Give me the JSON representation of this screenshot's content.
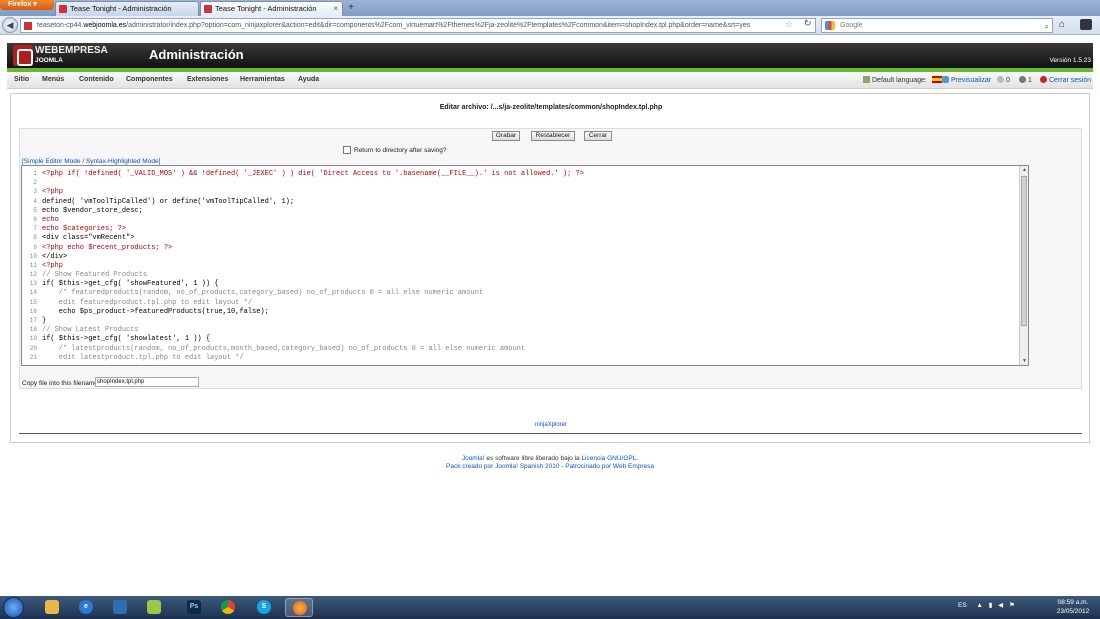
{
  "browser": {
    "menu_label": "Firefox",
    "tabs": [
      {
        "label": "Tease Tonight - Administración"
      },
      {
        "label": "Tease Tonight - Administración"
      }
    ],
    "new_tab_label": "+",
    "url_prefix": "teaseton-cp44.",
    "url_host": "webjoomla.es",
    "url_path": "/administrator/index.php?option=com_ninjaxplorer&action=edit&dir=components%2Fcom_virtuemart%2Fthemes%2Fja-zeolite%2Ftemplates%2Fcommon&item=shopIndex.tpl.php&order=name&srt=yes",
    "search_placeholder": "Google"
  },
  "header": {
    "brand": "WEBEMPRESA",
    "brand_sub": "JOOMLA",
    "title": "Administración",
    "version": "Versión 1.5.23",
    "accent_color": "#69ba2c"
  },
  "menu": {
    "items": [
      "Sitio",
      "Menús",
      "Contenido",
      "Componentes",
      "Extensiones",
      "Herramientas",
      "Ayuda"
    ],
    "default_language": "Default language:",
    "preview": "Previsualizar",
    "messages_count": "0",
    "users_count": "1",
    "logout": "Cerrar sesión"
  },
  "editor_page": {
    "title": "Editar archivo: /...s/ja-zeolite/templates/common/shopIndex.tpl.php",
    "buttons": {
      "save": "Grabar",
      "reset": "Restablecer",
      "close": "Cerrar"
    },
    "return_label": "Return to directory after saving?",
    "mode_link": "[Simple Editor Mode / Syntax-Highlighted Mode]",
    "copy_label": "Copy file into this filename",
    "copy_value": "shopIndex.tpl.php",
    "footer_link": "ninjaXplorer",
    "line_numbers": [
      "1",
      "2",
      "3",
      "4",
      "5",
      "6",
      "7",
      "8",
      "9",
      "10",
      "11",
      "12",
      "13",
      "14",
      "15",
      "16",
      "17",
      "18",
      "19",
      "20",
      "21"
    ],
    "code_lines": [
      "<?php if( !defined( '_VALID_MOS' ) && !defined( '_JEXEC' ) ) die( 'Direct Access to '.basename(__FILE__).' is not allowed.' ); ?>",
      "",
      "<?php",
      "defined( 'vmToolTipCalled') or define('vmToolTipCalled', 1);",
      "echo $vendor_store_desc;",
      "echo",
      "echo $categories; ?>",
      "<div class=\"vmRecent\">",
      "<?php echo $recent_products; ?>",
      "</div>",
      "<?php",
      "// Show Featured Products",
      "if( $this->get_cfg( 'showFeatured', 1 )) {",
      "    /* featuredproducts(random, no_of_products,category_based) no_of_products 0 = all else numeric amount",
      "    edit featuredproduct.tpl.php to edit layout */",
      "    echo $ps_product->featuredProducts(true,10,false);",
      "}",
      "// Show Latest Products",
      "if( $this->get_cfg( 'showlatest', 1 )) {",
      "    /* latestproducts(random, no_of_products,month_based,category_based) no_of_products 0 = all else numeric amount",
      "    edit latestproduct.tpl.php to edit layout */"
    ]
  },
  "footer": {
    "line1_link": "Joomla!",
    "line1_text": " es software libre liberado bajo la ",
    "line1_license": "Licencia GNU/GPL.",
    "line2": "Pack creado por Joomla! Spanish 2010 - Patrocinado por Web Empresa"
  },
  "taskbar": {
    "apps": [
      {
        "icon": "explorer-icon",
        "label": ""
      },
      {
        "icon": "ie-icon",
        "label": "e"
      },
      {
        "icon": "media-player-icon",
        "label": ""
      },
      {
        "icon": "winzip-icon",
        "label": ""
      },
      {
        "icon": "photoshop-icon",
        "label": "Ps"
      },
      {
        "icon": "chrome-icon",
        "label": ""
      },
      {
        "icon": "skype-icon",
        "label": "S"
      },
      {
        "icon": "firefox-icon",
        "label": ""
      }
    ],
    "language": "ES",
    "time": "08:59 a.m.",
    "date": "23/05/2012"
  }
}
